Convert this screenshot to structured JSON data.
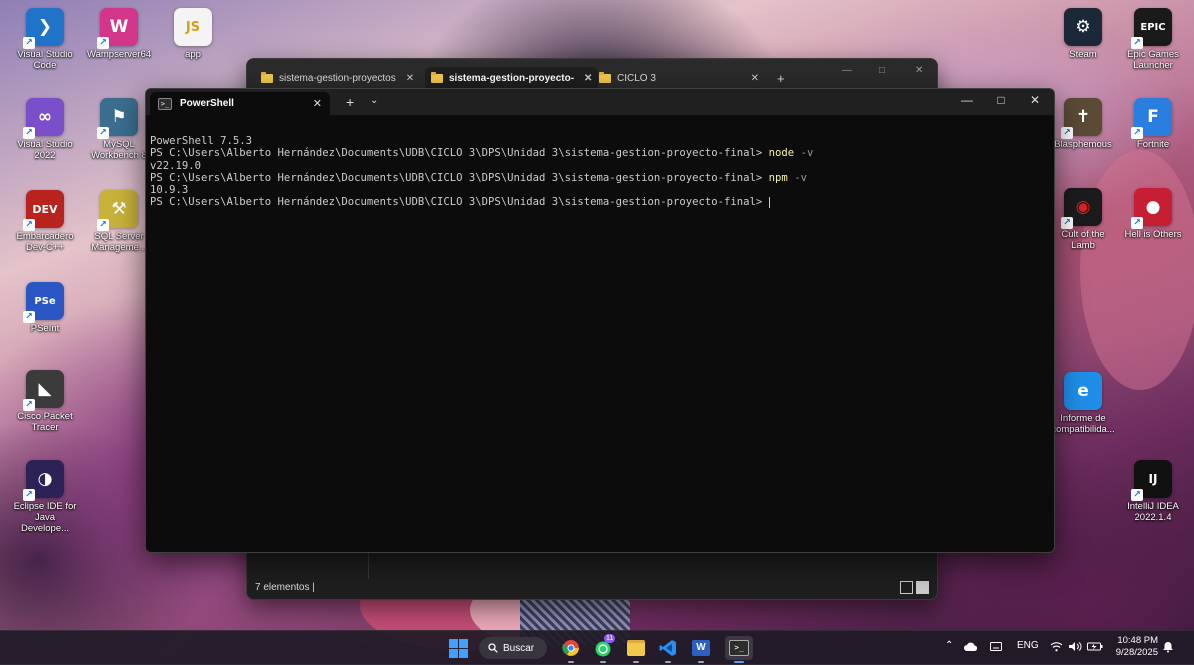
{
  "desktop": {
    "icons_left": [
      {
        "label": "Visual Studio Code",
        "symbol": "❯",
        "color": "#1f73c8"
      },
      {
        "label": "Wampserver64",
        "symbol": "W",
        "color": "#d3358a"
      },
      {
        "label": "app",
        "symbol": "JS",
        "color": "#f4f4f4"
      },
      {
        "label": "Visual Studio 2022",
        "symbol": "∞",
        "color": "#7b4fc9"
      },
      {
        "label": "MySQL Workbench 8",
        "symbol": "⚑",
        "color": "#3b6e8f"
      },
      {
        "label": "Embarcadero Dev-C++",
        "symbol": "DEV",
        "color": "#b8231d"
      },
      {
        "label": "SQL Server Manageme...",
        "symbol": "⚒",
        "color": "#c9b23a"
      },
      {
        "label": "PSeInt",
        "symbol": "PSe",
        "color": "#2a56c4"
      },
      {
        "label": "Cisco Packet Tracer",
        "symbol": "◣",
        "color": "#3b3b3b"
      },
      {
        "label": "Eclipse IDE for Java Develope...",
        "symbol": "◑",
        "color": "#2c2255"
      }
    ],
    "icons_right": [
      {
        "label": "Steam",
        "symbol": "⚙",
        "color": "#1b2838"
      },
      {
        "label": "Epic Games Launcher",
        "symbol": "EPIC",
        "color": "#1a1a1a"
      },
      {
        "label": "Blasphemous",
        "symbol": "✝",
        "color": "#5b4a36"
      },
      {
        "label": "Fortnite",
        "symbol": "F",
        "color": "#2a7ee0"
      },
      {
        "label": "Cult of the Lamb",
        "symbol": "◉",
        "color": "#1b1b1b"
      },
      {
        "label": "Hell is Others",
        "symbol": "●",
        "color": "#c61f33"
      },
      {
        "label": "Informe de compatibilida...",
        "symbol": "e",
        "color": "#1f8ee8"
      },
      {
        "label": "IntelliJ IDEA 2022.1.4",
        "symbol": "IJ",
        "color": "#111111"
      }
    ]
  },
  "explorer": {
    "tabs": [
      "sistema-gestion-proyectos",
      "sistema-gestion-proyecto-",
      "CICLO 3"
    ],
    "close_glyph": "✕",
    "new_tab_glyph": "+",
    "status": "7 elementos",
    "minimize_glyph": "—",
    "maximize_glyph": "□",
    "close_window_glyph": "✕"
  },
  "terminal": {
    "tab_title": "PowerShell",
    "ps_icon": ">_",
    "tab_close": "✕",
    "new_tab": "+",
    "dropdown": "⌄",
    "minimize": "—",
    "maximize": "□",
    "close": "✕",
    "lines": {
      "l1": "PowerShell 7.5.3",
      "prompt": "PS C:\\Users\\Alberto Hernández\\Documents\\UDB\\CICLO 3\\DPS\\Unidad 3\\sistema-gestion-proyecto-final> ",
      "cmd1": "node",
      "arg1": " -v",
      "out1": "v22.19.0",
      "cmd2": "npm",
      "arg2": " -v",
      "out2": "10.9.3"
    }
  },
  "taskbar": {
    "search_label": "Buscar",
    "language": "ENG",
    "time": "10:48 PM",
    "date": "9/28/2025",
    "chevron_up": "⌃",
    "chrome_badge": "11"
  }
}
